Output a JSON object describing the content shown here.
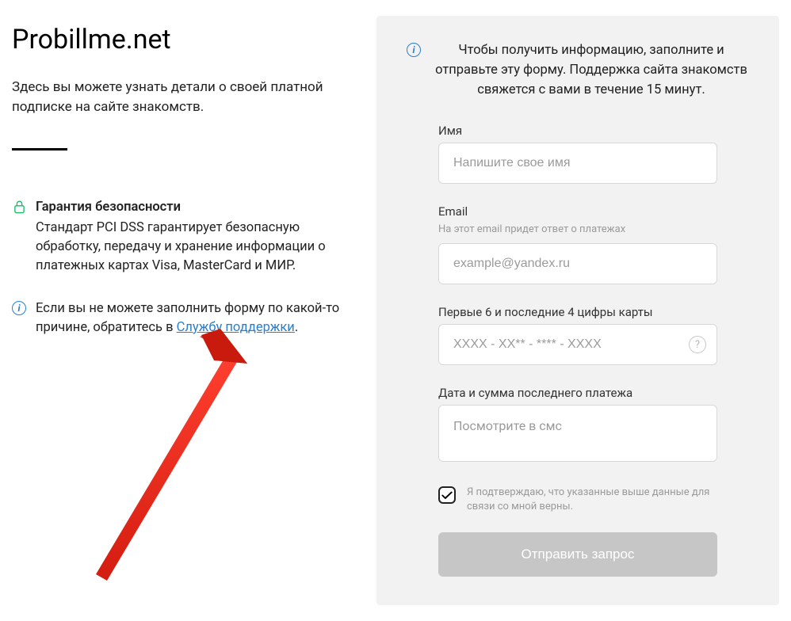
{
  "site": {
    "title": "Probillme.net"
  },
  "intro": "Здесь вы можете узнать детали о своей платной подписке на сайте знакомств.",
  "security": {
    "title": "Гарантия безопасности",
    "text": "Стандарт PCI DSS гарантирует безопасную обработку, передачу и хранение информации о платежных картах Visa, MasterCard и МИР."
  },
  "help": {
    "prefix": "Если вы не можете заполнить форму по какой-то причине, обратитесь в ",
    "link": "Службу поддержки",
    "suffix": "."
  },
  "form": {
    "intro": "Чтобы получить информацию, заполните и отправьте эту форму. Поддержка сайта знакомств свяжется с вами в течение 15 минут.",
    "name": {
      "label": "Имя",
      "placeholder": "Напишите свое имя"
    },
    "email": {
      "label": "Email",
      "hint": "На этот email придет ответ о платежах",
      "placeholder": "example@yandex.ru"
    },
    "card": {
      "label": "Первые 6 и последние 4 цифры карты",
      "placeholder": "XXXX - XX** - **** - XXXX"
    },
    "payment": {
      "label": "Дата и сумма последнего платежа",
      "placeholder": "Посмотрите в смс"
    },
    "consent": "Я подтверждаю, что указанные выше данные для связи со мной верны.",
    "submit": "Отправить запрос"
  }
}
